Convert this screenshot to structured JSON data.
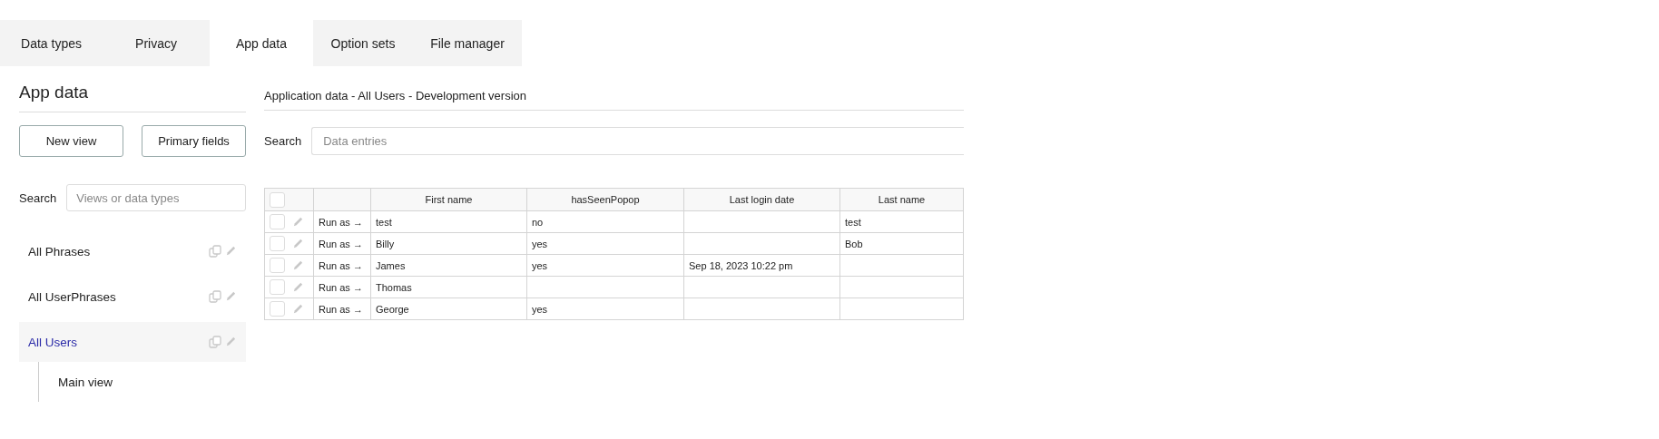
{
  "tabs": [
    {
      "label": "Data types",
      "selected": false
    },
    {
      "label": "Privacy",
      "selected": false
    },
    {
      "label": "App data",
      "selected": true
    },
    {
      "label": "Option sets",
      "selected": false
    },
    {
      "label": "File manager",
      "selected": false
    }
  ],
  "sidebar": {
    "title": "App data",
    "buttons": [
      "New view",
      "Primary fields"
    ],
    "search": {
      "label": "Search",
      "placeholder": "Views or data types"
    },
    "items": [
      {
        "label": "All Phrases",
        "selected": false
      },
      {
        "label": "All UserPhrases",
        "selected": false
      },
      {
        "label": "All Users",
        "selected": true,
        "children": [
          {
            "label": "Main view",
            "selected": false
          }
        ]
      }
    ]
  },
  "main": {
    "title": "Application data - All Users - Development version",
    "search": {
      "label": "Search",
      "placeholder": "Data entries"
    },
    "table": {
      "all_checked": false,
      "columns": [
        "First name",
        "hasSeenPopop",
        "Last login date",
        "Last name"
      ],
      "rows": [
        {
          "checked": false,
          "action": "Run as →",
          "cells": [
            "test",
            "no",
            null,
            "test"
          ]
        },
        {
          "checked": false,
          "action": "Run as →",
          "cells": [
            "Billy",
            "yes",
            null,
            "Bob"
          ]
        },
        {
          "checked": false,
          "action": "Run as →",
          "cells": [
            "James",
            "yes",
            "Sep 18, 2023 10:22 pm",
            null
          ]
        },
        {
          "checked": false,
          "action": "Run as →",
          "cells": [
            "Thomas",
            null,
            null,
            null
          ]
        },
        {
          "checked": false,
          "action": "Run as →",
          "cells": [
            "George",
            "yes",
            null,
            null
          ]
        }
      ]
    }
  }
}
